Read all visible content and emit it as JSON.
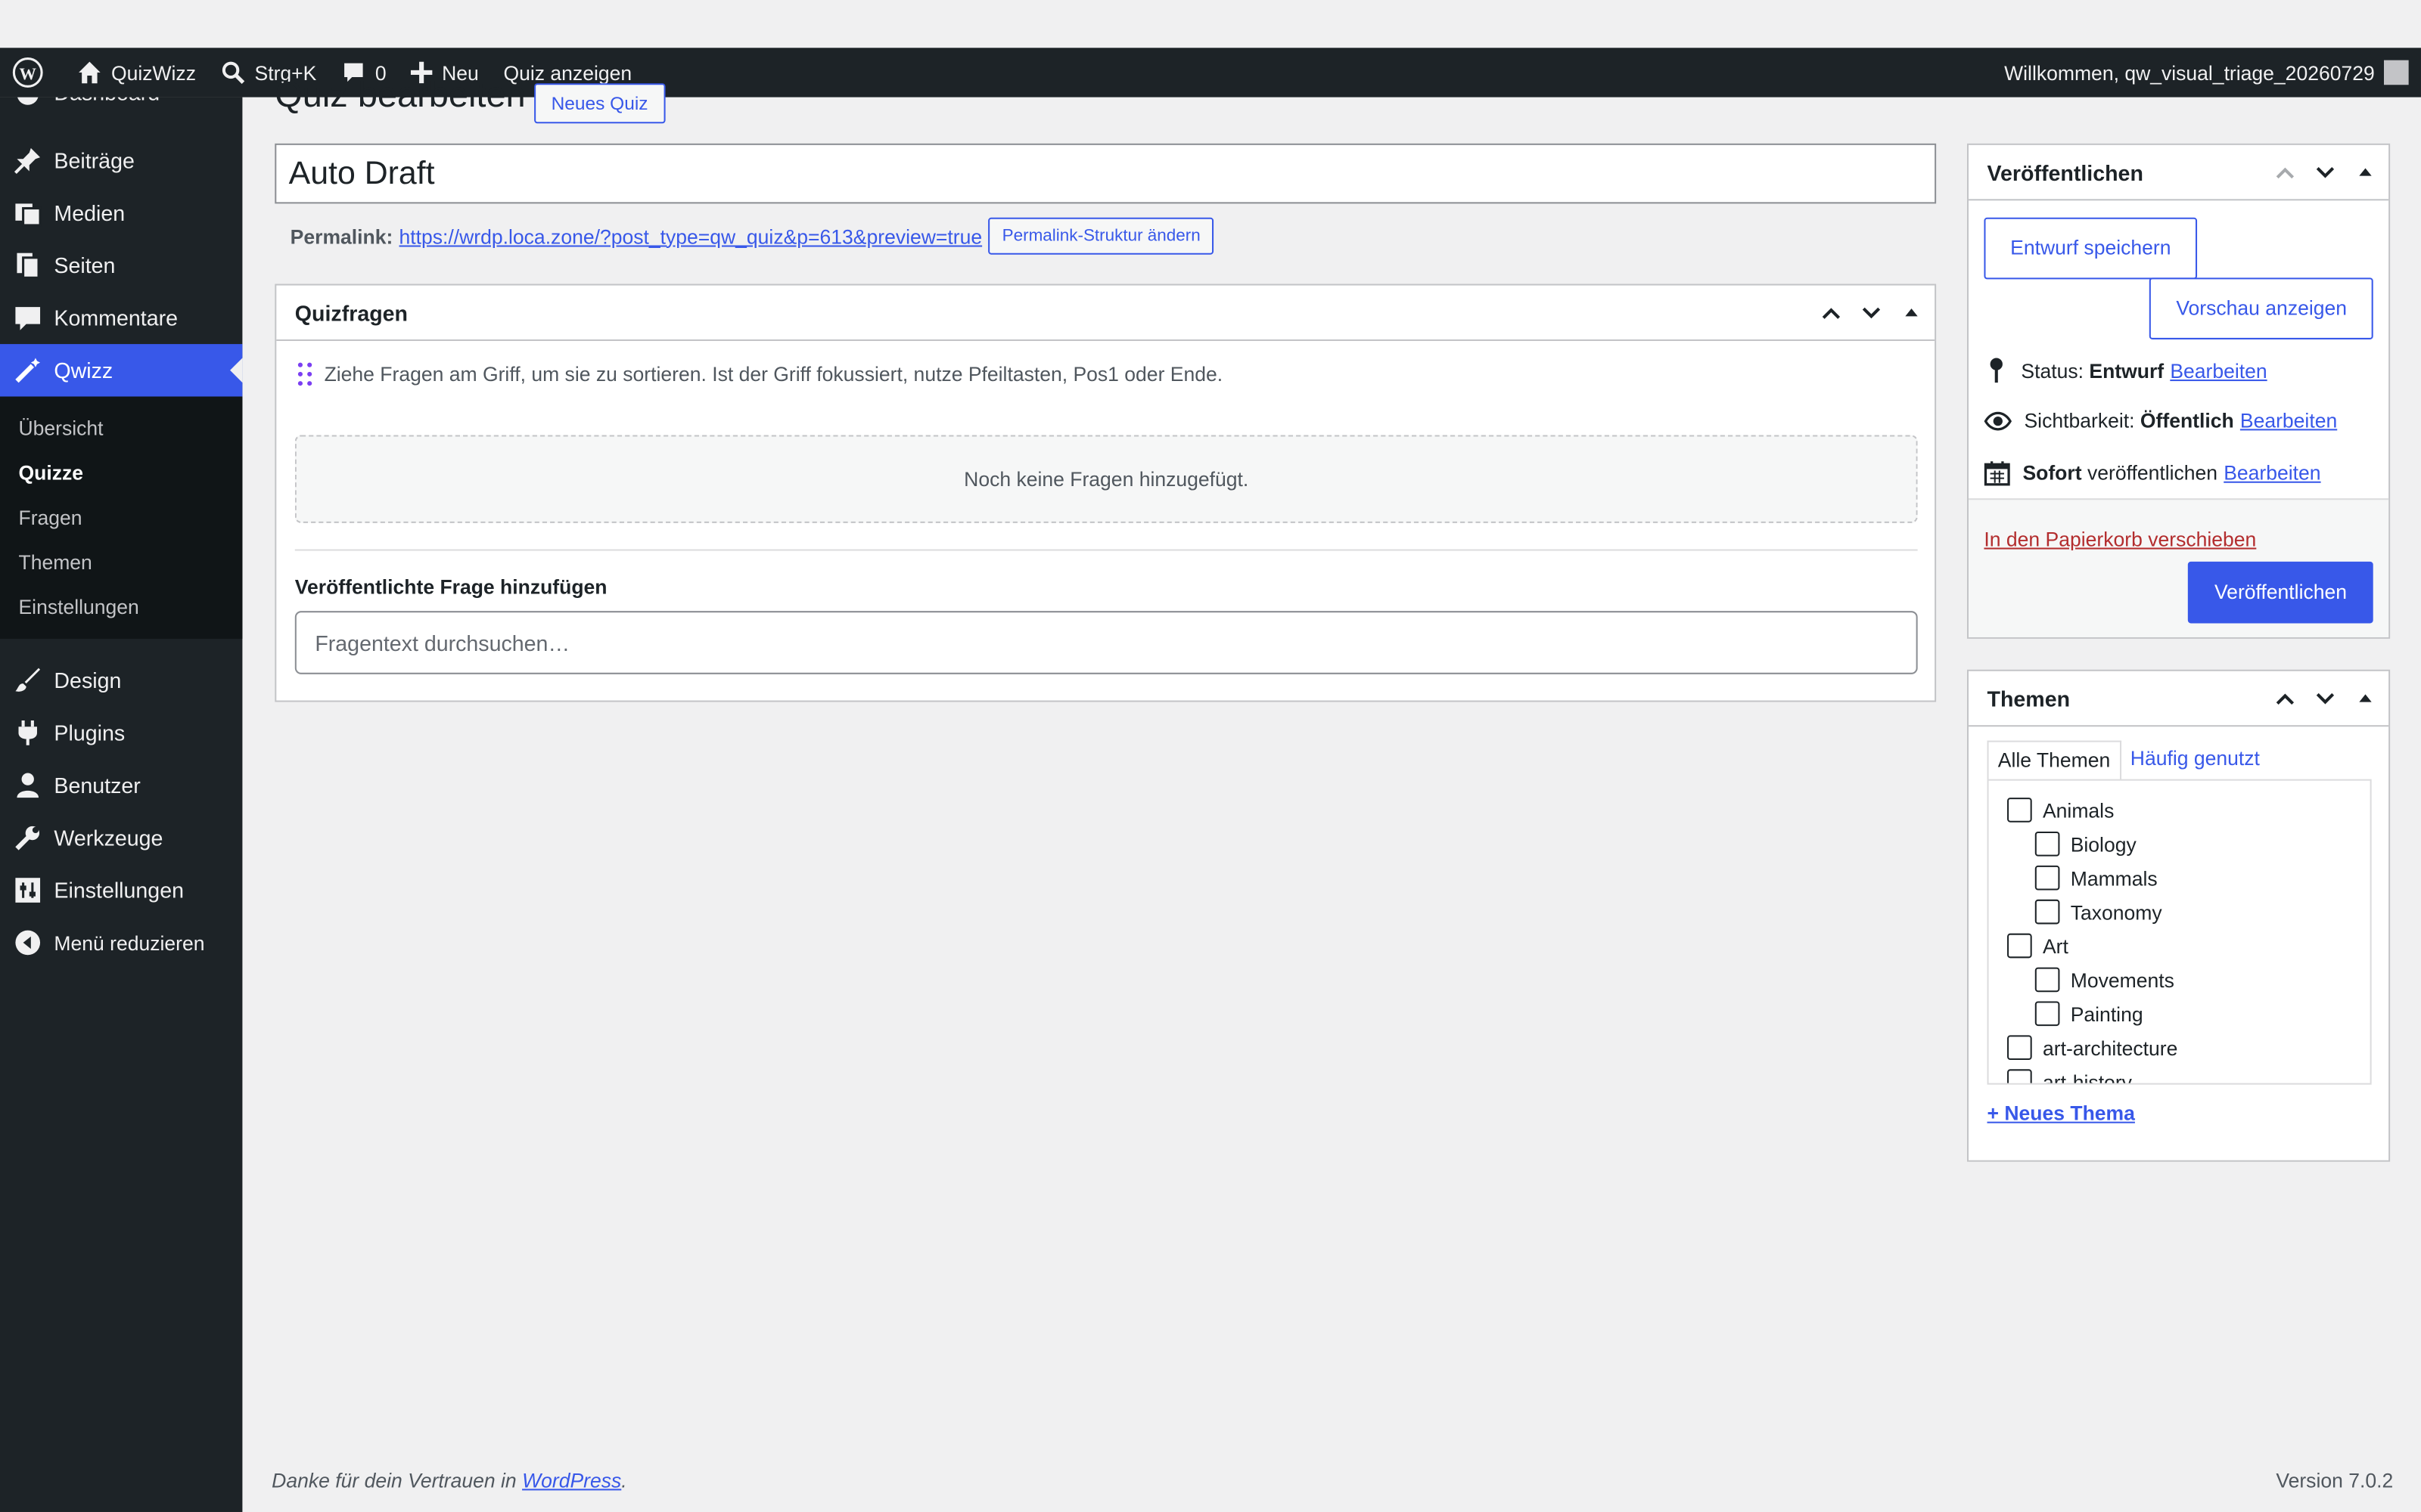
{
  "adminbar": {
    "site_name": "QuizWizz",
    "search_shortcut": "Strg+K",
    "comments_count": "0",
    "new_label": "Neu",
    "view_quiz": "Quiz anzeigen",
    "greeting": "Willkommen, qw_visual_triage_20260729"
  },
  "sidebar": {
    "clipped_item": "Dashboard",
    "items_top": [
      {
        "label": "Beiträge",
        "icon": "pin-icon"
      },
      {
        "label": "Medien",
        "icon": "media-icon"
      },
      {
        "label": "Seiten",
        "icon": "pages-icon"
      },
      {
        "label": "Kommentare",
        "icon": "comments-icon"
      },
      {
        "label": "Qwizz",
        "icon": "wand-icon"
      }
    ],
    "submenu": [
      "Übersicht",
      "Quizze",
      "Fragen",
      "Themen",
      "Einstellungen"
    ],
    "items_bottom": [
      {
        "label": "Design",
        "icon": "brush-icon"
      },
      {
        "label": "Plugins",
        "icon": "plug-icon"
      },
      {
        "label": "Benutzer",
        "icon": "user-icon"
      },
      {
        "label": "Werkzeuge",
        "icon": "wrench-icon"
      },
      {
        "label": "Einstellungen",
        "icon": "settings-icon"
      },
      {
        "label": "Menü reduzieren",
        "icon": "collapse-icon"
      }
    ]
  },
  "main": {
    "page_title": "Quiz bearbeiten",
    "new_quiz_button": "Neues Quiz",
    "title_value": "Auto Draft",
    "permalink_label": "Permalink:",
    "permalink_url": "https://wrdp.loca.zone/?post_type=qw_quiz&p=613&preview=true",
    "permalink_button": "Permalink-Struktur ändern"
  },
  "questions_box": {
    "title": "Quizfragen",
    "sort_hint": "Ziehe Fragen am Griff, um sie zu sortieren. Ist der Griff fokussiert, nutze Pfeiltasten, Pos1 oder Ende.",
    "empty_text": "Noch keine Fragen hinzugefügt.",
    "add_label": "Veröffentlichte Frage hinzufügen",
    "search_placeholder": "Fragentext durchsuchen…"
  },
  "publish_box": {
    "title": "Veröffentlichen",
    "save_draft": "Entwurf speichern",
    "preview": "Vorschau anzeigen",
    "status_label": "Status:",
    "status_value": "Entwurf",
    "visibility_label": "Sichtbarkeit:",
    "visibility_value": "Öffentlich",
    "schedule_value": "Sofort",
    "schedule_label": "veröffentlichen",
    "edit_link": "Bearbeiten",
    "trash": "In den Papierkorb verschieben",
    "publish_button": "Veröffentlichen"
  },
  "topics_box": {
    "title": "Themen",
    "tab_all": "Alle Themen",
    "tab_popular": "Häufig genutzt",
    "categories": [
      {
        "label": "Animals",
        "level": 0
      },
      {
        "label": "Biology",
        "level": 1
      },
      {
        "label": "Mammals",
        "level": 1
      },
      {
        "label": "Taxonomy",
        "level": 1
      },
      {
        "label": "Art",
        "level": 0
      },
      {
        "label": "Movements",
        "level": 1
      },
      {
        "label": "Painting",
        "level": 1
      },
      {
        "label": "art-architecture",
        "level": 0
      },
      {
        "label": "art-history",
        "level": 0
      }
    ],
    "new_topic": "+ Neues Thema"
  },
  "footer": {
    "thanks_prefix": "Danke für dein Vertrauen in",
    "wordpress": "WordPress",
    "version": "Version 7.0.2"
  },
  "colors": {
    "accent": "#3858e9",
    "adminbar": "#1d2327",
    "danger": "#b32d2e"
  }
}
